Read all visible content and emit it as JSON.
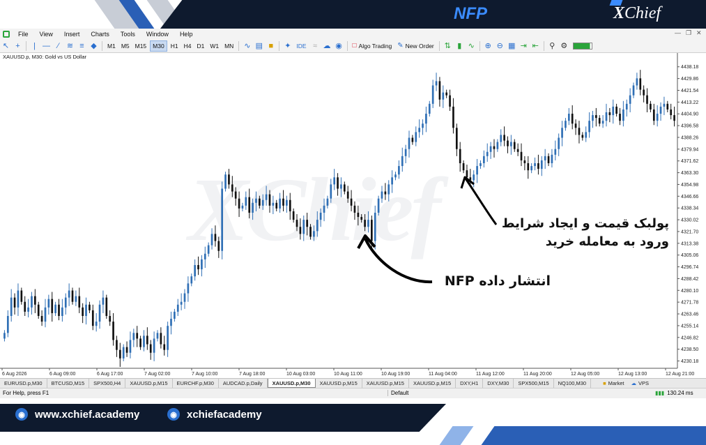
{
  "banner": {
    "title": "NFP",
    "logo_prefix": "X",
    "logo_rest": "Chief"
  },
  "menu": [
    "File",
    "View",
    "Insert",
    "Charts",
    "Tools",
    "Window",
    "Help"
  ],
  "toolbar": {
    "timeframes": [
      "M1",
      "M5",
      "M15",
      "M30",
      "H1",
      "H4",
      "D1",
      "W1",
      "MN"
    ],
    "active_timeframe": "M30",
    "ide_label": "IDE",
    "algo_trading_label": "Algo Trading",
    "new_order_label": "New Order"
  },
  "chart": {
    "symbol_label": "XAUUSD.p, M30:  Gold vs US Dollar",
    "price_labels": [
      "4438.18",
      "4429.86",
      "4421.54",
      "4413.22",
      "4404.90",
      "4396.58",
      "4388.26",
      "4379.94",
      "4371.62",
      "4363.30",
      "4354.98",
      "4346.66",
      "4338.34",
      "4330.02",
      "4321.70",
      "4313.38",
      "4305.06",
      "4296.74",
      "4288.42",
      "4280.10",
      "4271.78",
      "4263.46",
      "4255.14",
      "4246.82",
      "4238.50",
      "4230.18"
    ],
    "time_labels": [
      "6 Aug 2026",
      "6 Aug 09:00",
      "6 Aug 17:00",
      "7 Aug 02:00",
      "7 Aug 10:00",
      "7 Aug 18:00",
      "10 Aug 03:00",
      "10 Aug 11:00",
      "10 Aug 19:00",
      "11 Aug 04:00",
      "11 Aug 12:00",
      "11 Aug 20:00",
      "12 Aug 05:00",
      "12 Aug 13:00",
      "12 Aug 21:00"
    ],
    "watermark": "XChief",
    "annotation_pullback_line1": "پولبک قیمت و ایجاد شرایط",
    "annotation_pullback_line2": "ورود به معامله خرید",
    "annotation_nfp": "انتشار داده NFP",
    "up_color": "#2f6fb5",
    "down_color": "#111111"
  },
  "chart_data": {
    "type": "candlestick",
    "title": "",
    "ylim": [
      4226,
      4442
    ],
    "close_path": [
      4250,
      4262,
      4275,
      4268,
      4280,
      4272,
      4265,
      4268,
      4276,
      4270,
      4262,
      4258,
      4268,
      4274,
      4264,
      4270,
      4262,
      4268,
      4275,
      4280,
      4272,
      4276,
      4268,
      4262,
      4270,
      4266,
      4255,
      4258,
      4270,
      4275,
      4262,
      4258,
      4245,
      4238,
      4232,
      4240,
      4236,
      4245,
      4250,
      4246,
      4240,
      4248,
      4242,
      4236,
      4246,
      4250,
      4242,
      4238,
      4255,
      4260,
      4265,
      4270,
      4272,
      4278,
      4285,
      4290,
      4298,
      4295,
      4302,
      4306,
      4312,
      4320,
      4315,
      4308,
      4352,
      4362,
      4355,
      4350,
      4345,
      4338,
      4340,
      4346,
      4335,
      4342,
      4345,
      4340,
      4344,
      4348,
      4340,
      4342,
      4338,
      4345,
      4340,
      4344,
      4336,
      4330,
      4325,
      4320,
      4330,
      4325,
      4318,
      4322,
      4330,
      4335,
      4340,
      4345,
      4355,
      4360,
      4352,
      4355,
      4350,
      4345,
      4340,
      4335,
      4332,
      4330,
      4325,
      4330,
      4315,
      4335,
      4345,
      4350,
      4348,
      4355,
      4360,
      4362,
      4368,
      4375,
      4380,
      4388,
      4385,
      4392,
      4395,
      4398,
      4405,
      4412,
      4425,
      4428,
      4415,
      4420,
      4418,
      4410,
      4395,
      4380,
      4370,
      4365,
      4360,
      4358,
      4362,
      4368,
      4370,
      4375,
      4378,
      4382,
      4380,
      4385,
      4390,
      4386,
      4382,
      4385,
      4380,
      4378,
      4372,
      4370,
      4365,
      4368,
      4370,
      4366,
      4372,
      4375,
      4370,
      4376,
      4380,
      4388,
      4395,
      4400,
      4405,
      4398,
      4395,
      4390,
      4388,
      4392,
      4400,
      4404,
      4402,
      4398,
      4400,
      4406,
      4404,
      4410,
      4405,
      4400,
      4408,
      4412,
      4418,
      4425,
      4430,
      4422,
      4418,
      4412,
      4408,
      4400,
      4405,
      4410,
      4412,
      4408,
      4404,
      4400
    ],
    "price_unit": "USD"
  },
  "tabs": {
    "items": [
      "EURUSD.p,M30",
      "BTCUSD,M15",
      "SPX500,H4",
      "XAUUSD.p,M15",
      "EURCHF.p,M30",
      "AUDCAD.p,Daily",
      "XAUUSD.p,M30",
      "XAUUSD.p,M15",
      "XAUUSD.p,M15",
      "XAUUSD.p,M15",
      "DXY,H1",
      "DXY,M30",
      "SPX500,M15",
      "NQ100,M30"
    ],
    "active_index": 6,
    "market_label": "Market",
    "vps_label": "VPS"
  },
  "status": {
    "help": "For Help, press F1",
    "profile": "Default",
    "ping": "130.24 ms"
  },
  "footer": {
    "website": "www.xchief.academy",
    "instagram": "xchiefacademy"
  }
}
